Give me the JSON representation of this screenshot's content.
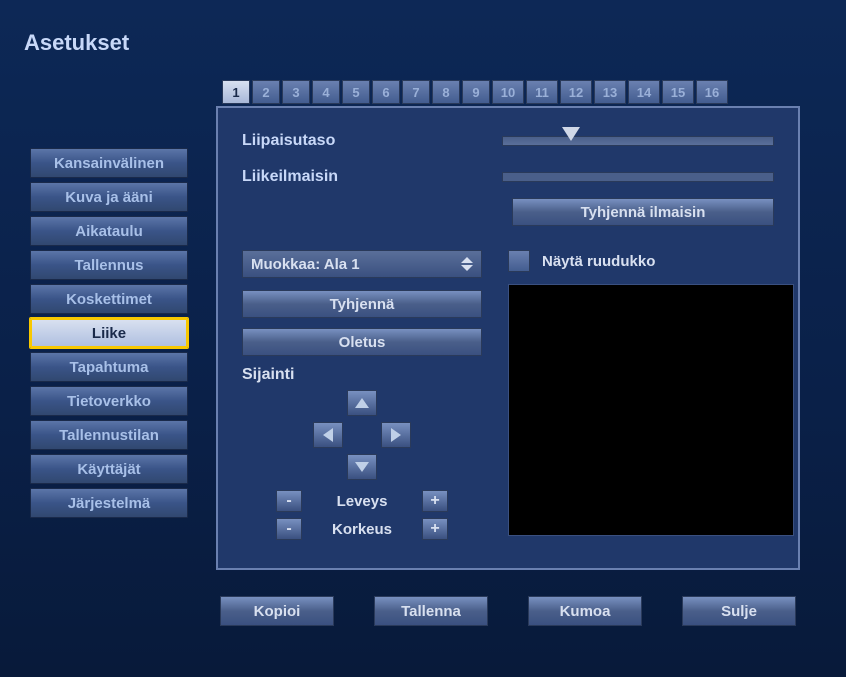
{
  "title": "Asetukset",
  "sidebar": {
    "items": [
      {
        "label": "Kansainvälinen",
        "active": false
      },
      {
        "label": "Kuva ja ääni",
        "active": false
      },
      {
        "label": "Aikataulu",
        "active": false
      },
      {
        "label": "Tallennus",
        "active": false
      },
      {
        "label": "Koskettimet",
        "active": false
      },
      {
        "label": "Liike",
        "active": true
      },
      {
        "label": "Tapahtuma",
        "active": false
      },
      {
        "label": "Tietoverkko",
        "active": false
      },
      {
        "label": "Tallennustilan",
        "active": false
      },
      {
        "label": "Käyttäjät",
        "active": false
      },
      {
        "label": "Järjestelmä",
        "active": false
      }
    ]
  },
  "tabs": {
    "items": [
      "1",
      "2",
      "3",
      "4",
      "5",
      "6",
      "7",
      "8",
      "9",
      "10",
      "11",
      "12",
      "13",
      "14",
      "15",
      "16"
    ],
    "active_index": 0
  },
  "panel": {
    "trigger_label": "Liipaisutaso",
    "trigger_value_pct": 22,
    "indicator_label": "Liikeilmaisin",
    "clear_indicator_btn": "Tyhjennä ilmaisin",
    "edit_select_label": "Muokkaa: Ala 1",
    "show_grid_label": "Näytä ruudukko",
    "show_grid_checked": false,
    "clear_btn": "Tyhjennä",
    "default_btn": "Oletus",
    "position_label": "Sijainti",
    "width_label": "Leveys",
    "height_label": "Korkeus",
    "minus": "-",
    "plus": "+"
  },
  "footer": {
    "copy": "Kopioi",
    "save": "Tallenna",
    "undo": "Kumoa",
    "close": "Sulje"
  }
}
